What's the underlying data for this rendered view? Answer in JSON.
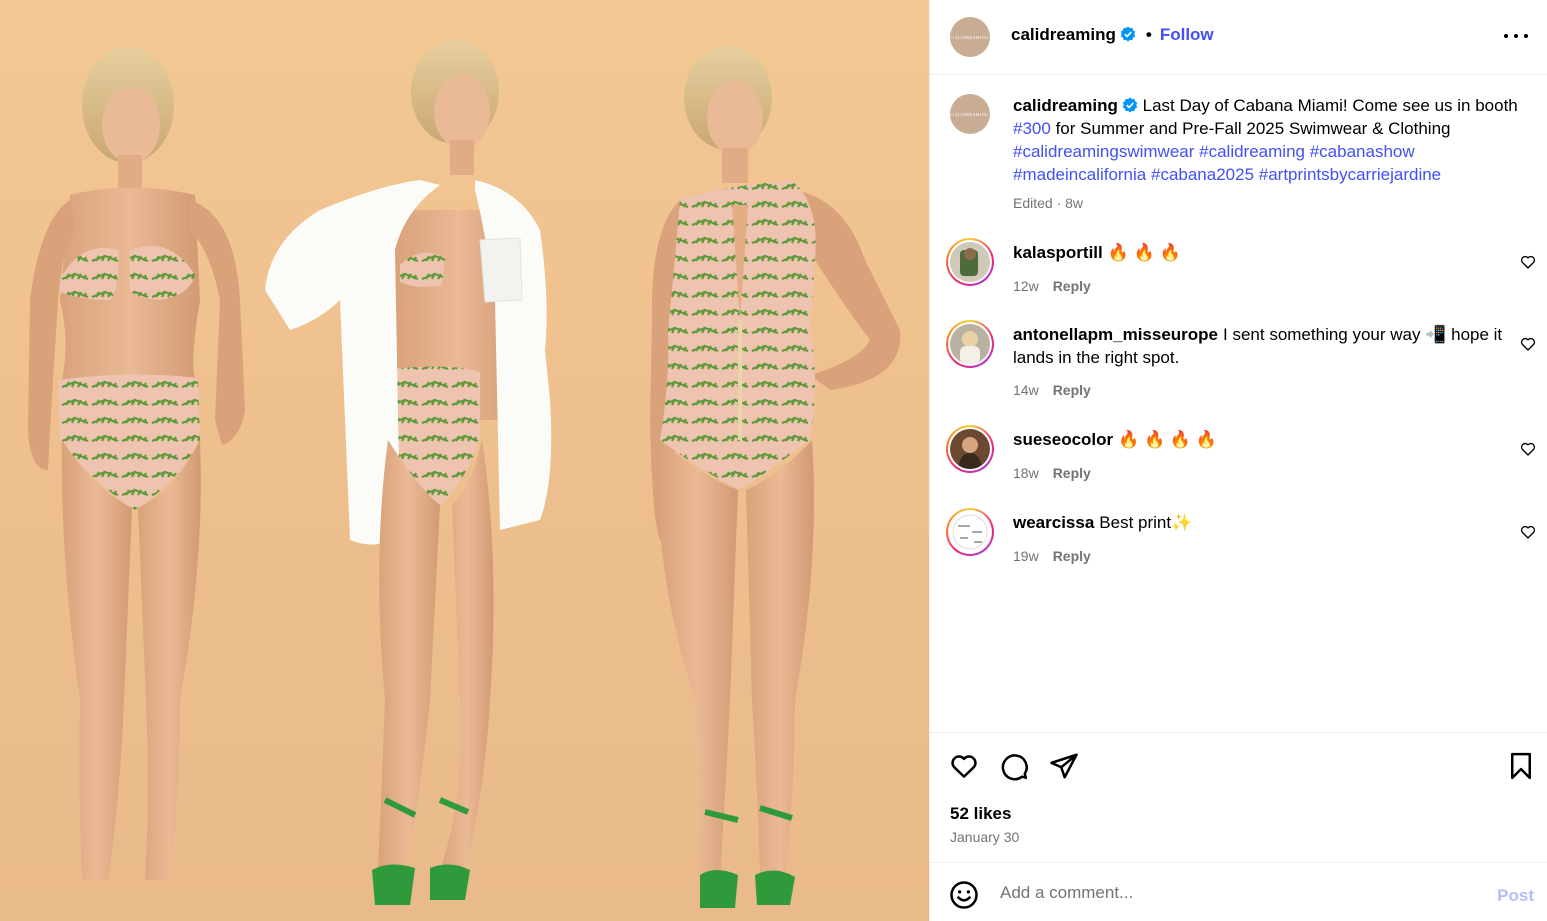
{
  "media": {
    "alt_icon": "photo",
    "background_color": "#efc48f"
  },
  "header": {
    "avatar_text": "CALIDREAMING",
    "username": "calidreaming",
    "separator": "•",
    "follow_label": "Follow",
    "more_icon": "more-horizontal-icon"
  },
  "caption": {
    "avatar_text": "CALIDREAMING",
    "username": "calidreaming",
    "text_part1": "Last Day of Cabana Miami! Come see us in booth",
    "booth_tag": "#300",
    "text_part2": "for Summer and Pre-Fall 2025 Swimwear & Clothing",
    "hashtags": [
      "#calidreamingswimwear",
      "#calidreaming",
      "#cabanashow",
      "#madeincalifornia",
      "#cabana2025",
      "#artprintsbycarriejardine"
    ],
    "edited": "Edited · 8w"
  },
  "comments": [
    {
      "username": "kalasportill",
      "text": "🔥 🔥 🔥",
      "time": "12w",
      "reply": "Reply"
    },
    {
      "username": "antonellapm_misseurope",
      "text": "I sent something your way 📲 hope it lands in the right spot.",
      "time": "14w",
      "reply": "Reply"
    },
    {
      "username": "sueseocolor",
      "text": "🔥 🔥 🔥 🔥",
      "time": "18w",
      "reply": "Reply"
    },
    {
      "username": "wearcissa",
      "text": "Best print✨",
      "time": "19w",
      "reply": "Reply"
    }
  ],
  "actions": {
    "likes": "52 likes",
    "date": "January 30"
  },
  "comment_box": {
    "placeholder": "Add a comment...",
    "post_label": "Post"
  },
  "colors": {
    "link": "#4150f7",
    "muted": "#737373",
    "verified": "#0095f6",
    "post_disabled": "#b4bdf9"
  }
}
